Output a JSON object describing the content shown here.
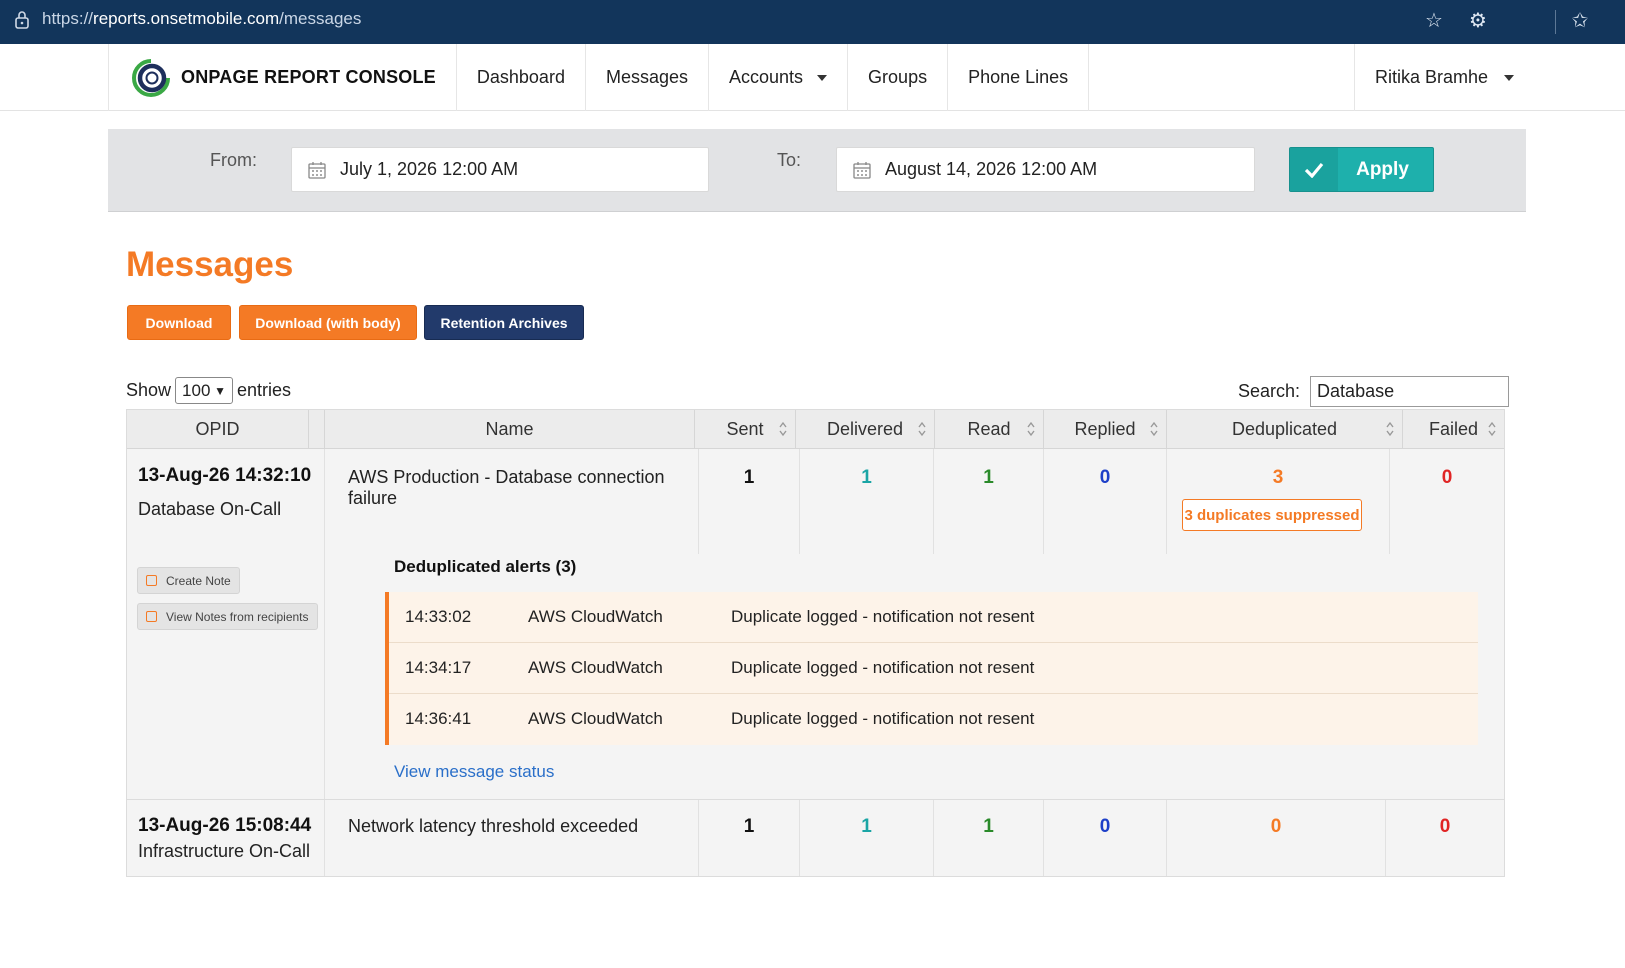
{
  "browser": {
    "url_prefix": "https://",
    "url_host": "reports.onsetmobile.com",
    "url_path": "/messages"
  },
  "nav": {
    "brand": "ONPAGE REPORT CONSOLE",
    "items": [
      {
        "label": "Dashboard",
        "dropdown": false
      },
      {
        "label": "Messages",
        "dropdown": false
      },
      {
        "label": "Accounts",
        "dropdown": true
      },
      {
        "label": "Groups",
        "dropdown": false
      },
      {
        "label": "Phone Lines",
        "dropdown": false
      }
    ],
    "user": "Ritika Bramhe"
  },
  "filter": {
    "from_label": "From:",
    "from_value": "July 1, 2026 12:00 AM",
    "to_label": "To:",
    "to_value": "August 14, 2026 12:00 AM",
    "apply_label": "Apply"
  },
  "page": {
    "title": "Messages",
    "download_label": "Download",
    "download_body_label": "Download (with body)",
    "retention_label": "Retention Archives"
  },
  "table_controls": {
    "show_label": "Show",
    "entries_value": "100",
    "entries_label": "entries",
    "search_label": "Search:",
    "search_value": "Database"
  },
  "table": {
    "headers": [
      "OPID",
      "Name",
      "Sent",
      "Delivered",
      "Read",
      "Replied",
      "Deduplicated",
      "Failed"
    ],
    "rows": [
      {
        "time": "13-Aug-26 14:32:10",
        "group": "Database On-Call",
        "name": "AWS Production - Database connection failure",
        "sent": "1",
        "delivered": "1",
        "read": "1",
        "replied": "0",
        "deduplicated": "3",
        "failed": "0",
        "dup_badge": "3 duplicates suppressed",
        "create_note": "Create Note",
        "view_notes": "View Notes from recipients",
        "dedup_title": "Deduplicated alerts (3)",
        "dedup_alerts": [
          {
            "time": "14:33:02",
            "source": "AWS CloudWatch",
            "status": "Duplicate logged - notification not resent"
          },
          {
            "time": "14:34:17",
            "source": "AWS CloudWatch",
            "status": "Duplicate logged - notification not resent"
          },
          {
            "time": "14:36:41",
            "source": "AWS CloudWatch",
            "status": "Duplicate logged - notification not resent"
          }
        ],
        "status_link": "View message status"
      },
      {
        "time": "13-Aug-26 15:08:44",
        "group": "Infrastructure On-Call",
        "name": "Network latency threshold exceeded",
        "sent": "1",
        "delivered": "1",
        "read": "1",
        "replied": "0",
        "deduplicated": "0",
        "failed": "0"
      }
    ]
  },
  "colors": {
    "accent_orange": "#f47a25",
    "apply_teal": "#1eb0ac",
    "navy": "#223a6b",
    "browser_bar": "#12355b"
  }
}
